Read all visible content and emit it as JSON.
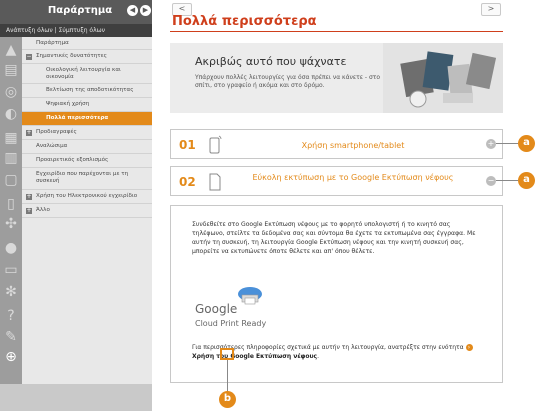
{
  "sidebar": {
    "title": "Παράρτημα",
    "expand_all": "Ανάπτυξη όλων | Σύμπτυξη όλων",
    "items": [
      {
        "label": "Παράρτημα",
        "level": 0
      },
      {
        "label": "Σημαντικές δυνατότητες",
        "level": 0,
        "toggle": "−"
      },
      {
        "label": "Οικολογική λειτουργία και οικονομία",
        "level": 1
      },
      {
        "label": "Βελτίωση της αποδοτικότητας",
        "level": 1
      },
      {
        "label": "Ψηφιακή χρήση",
        "level": 1
      },
      {
        "label": "Πολλά περισσότερα",
        "level": 1,
        "selected": true
      },
      {
        "label": "Προδιαγραφές",
        "level": 0,
        "toggle": "+"
      },
      {
        "label": "Αναλώσιμα",
        "level": 0
      },
      {
        "label": "Προαιρετικός εξοπλισμός",
        "level": 0
      },
      {
        "label": "Εγχειρίδιο που παρέχονται με τη συσκευή",
        "level": 0
      },
      {
        "label": "Χρήση του Ηλεκτρονικού εγχειρίδιο",
        "level": 0,
        "toggle": "+"
      },
      {
        "label": "Άλλο",
        "level": 0,
        "toggle": "+"
      }
    ],
    "rail_icons": [
      "warning-icon",
      "book-icon",
      "copy-icon",
      "link-icon",
      "printer-icon",
      "fax-icon",
      "scan-icon",
      "phone-icon",
      "network-icon",
      "lock-icon",
      "monitor-icon",
      "gear-icon",
      "help-icon",
      "wrench-icon",
      "plus-icon"
    ]
  },
  "nav": {
    "prev": "<",
    "next": ">"
  },
  "main": {
    "title": "Πολλά περισσότερα",
    "banner": {
      "heading": "Ακριβώς αυτό που ψάχνατε",
      "text": "Υπάρχουν πολλές λειτουργίες για όσα πρέπει να κάνετε - στο σπίτι, στο γραφείο ή ακόμα και στο δρόμο."
    },
    "features": [
      {
        "num": "01",
        "label": "Χρήση smartphone/tablet",
        "icon": "smartphone-icon",
        "toggle": "+"
      },
      {
        "num": "02",
        "label": "Εύκολη εκτύπωση με το Google Εκτύπωση νέφους",
        "icon": "document-icon",
        "toggle": "−"
      }
    ],
    "detail": {
      "paragraph": "Συνδεθείτε στο Google Εκτύπωση νέφους με το φορητό υπολογιστή ή το κινητό σας τηλέφωνο, στείλτε τα δεδομένα σας και σύντομα θα έχετε τα εκτυπωμένα σας έγγραφα. Με αυτήν τη συσκευή, τη λειτουργία Google Εκτύπωση νέφους και την κινητή συσκευή σας, μπορείτε να εκτυπώνετε όποτε θέλετε και απ' όπου θέλετε.",
      "logo_word": "Google",
      "logo_sub": "Cloud Print Ready",
      "foot_pre": "Για περισσότερες πληροφορίες σχετικά με αυτήν τη λειτουργία, ανατρέξτε στην ενότητα",
      "foot_link": "Χρήση του Google Εκτύπωση νέφους",
      "foot_post": "."
    }
  },
  "callouts": {
    "a1": "a",
    "a2": "a",
    "b": "b"
  },
  "colors": {
    "accent": "#e38a1a",
    "title": "#cf3f1c",
    "sidebar_header": "#5a5a5a"
  }
}
